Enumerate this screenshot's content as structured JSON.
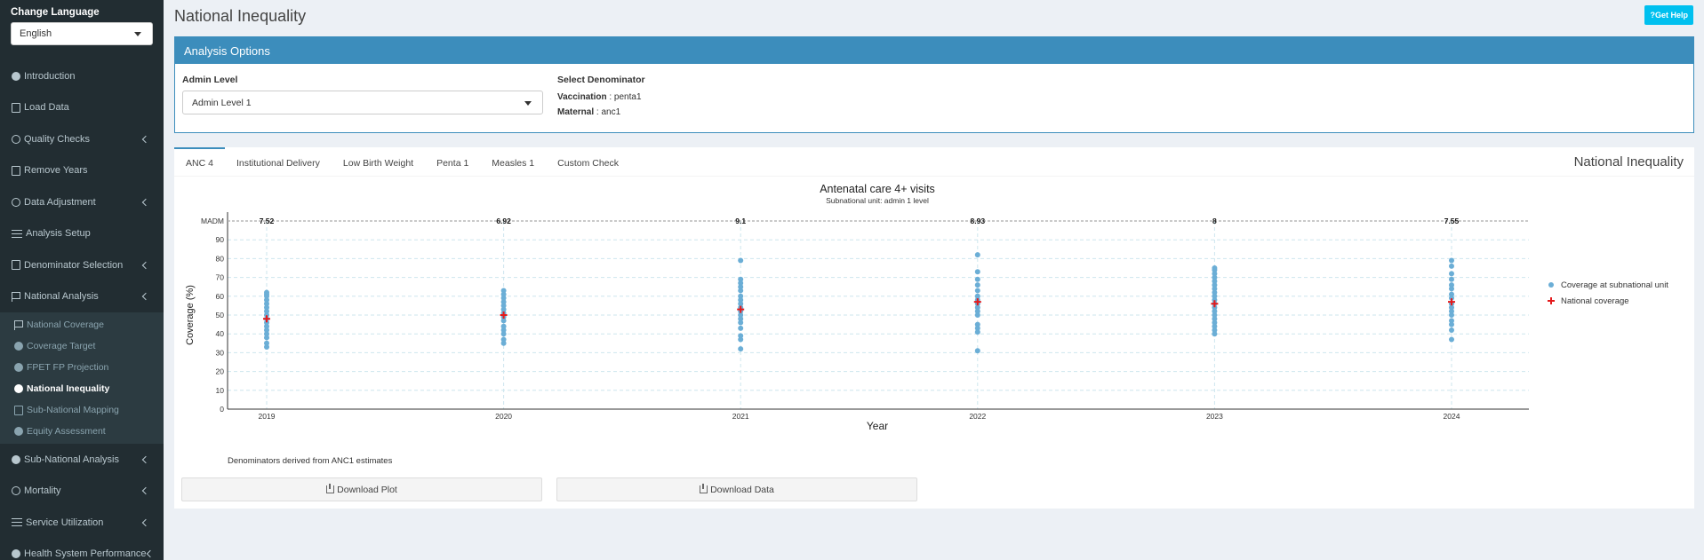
{
  "sidebar": {
    "language_title": "Change Language",
    "language_value": "English",
    "items": [
      {
        "label": "Introduction",
        "icon": "info-circle-icon"
      },
      {
        "label": "Load Data",
        "icon": "upload-icon"
      },
      {
        "label": "Quality Checks",
        "icon": "check-circle-icon",
        "expandable": true
      },
      {
        "label": "Remove Years",
        "icon": "trash-icon"
      },
      {
        "label": "Data Adjustment",
        "icon": "adjust-icon",
        "expandable": true
      },
      {
        "label": "Analysis Setup",
        "icon": "sliders-icon"
      },
      {
        "label": "Denominator Selection",
        "icon": "calculator-icon",
        "expandable": true
      },
      {
        "label": "National Analysis",
        "icon": "flag-icon",
        "expandable": true
      }
    ],
    "sub_items": [
      {
        "label": "National Coverage",
        "icon": "flag-icon"
      },
      {
        "label": "Coverage Target",
        "icon": "user-icon"
      },
      {
        "label": "FPET FP Projection",
        "icon": "user-icon"
      },
      {
        "label": "National Inequality",
        "icon": "balance-icon",
        "active": true
      },
      {
        "label": "Sub-National Mapping",
        "icon": "map-icon"
      },
      {
        "label": "Equity Assessment",
        "icon": "balance-icon"
      }
    ],
    "items_after": [
      {
        "label": "Sub-National Analysis",
        "icon": "globe-icon",
        "expandable": true
      },
      {
        "label": "Mortality",
        "icon": "balance-icon",
        "expandable": true
      },
      {
        "label": "Service Utilization",
        "icon": "sliders-icon",
        "expandable": true
      },
      {
        "label": "Health System Performance",
        "icon": "globe-icon",
        "expandable": true
      }
    ]
  },
  "header": {
    "title": "National Inequality",
    "help_label": "Get Help"
  },
  "analysis_options": {
    "title": "Analysis Options",
    "admin_level_label": "Admin Level",
    "admin_level_value": "Admin Level 1",
    "denominator_title": "Select Denominator",
    "vaccination_label": "Vaccination",
    "vaccination_value": " : penta1",
    "maternal_label": "Maternal",
    "maternal_value": " : anc1"
  },
  "tabs": {
    "items": [
      "ANC 4",
      "Institutional Delivery",
      "Low Birth Weight",
      "Penta 1",
      "Measles 1",
      "Custom Check"
    ],
    "active": 0,
    "panel_title": "National Inequality"
  },
  "chart_data": {
    "type": "scatter",
    "title": "Antenatal care 4+ visits",
    "subtitle": "Subnational unit: admin 1 level",
    "xlabel": "Year",
    "ylabel": "Coverage (%)",
    "ylim": [
      0,
      100
    ],
    "yticks": [
      0,
      10,
      20,
      30,
      40,
      50,
      60,
      70,
      80,
      90
    ],
    "madm_label": "MADM",
    "madm_y": 100,
    "categories": [
      "2019",
      "2020",
      "2021",
      "2022",
      "2023",
      "2024"
    ],
    "madm_values": [
      "7.52",
      "6.92",
      "9.1",
      "8.93",
      "8",
      "7.55"
    ],
    "series": [
      {
        "name": "Coverage at subnational unit",
        "color": "#6baed6",
        "points": [
          [
            33,
            35,
            38,
            40,
            42,
            44,
            46,
            48,
            50,
            52,
            54,
            56,
            58,
            60,
            61,
            62
          ],
          [
            35,
            37,
            40,
            42,
            44,
            47,
            49,
            51,
            53,
            55,
            57,
            59,
            61,
            63
          ],
          [
            32,
            37,
            39,
            43,
            46,
            48,
            50,
            52,
            54,
            56,
            58,
            60,
            63,
            65,
            67,
            69,
            79
          ],
          [
            31,
            41,
            43,
            45,
            50,
            52,
            54,
            56,
            58,
            60,
            63,
            66,
            69,
            73,
            82
          ],
          [
            40,
            42,
            44,
            46,
            48,
            50,
            52,
            54,
            56,
            58,
            60,
            62,
            64,
            66,
            68,
            70,
            72,
            74,
            75
          ],
          [
            37,
            42,
            45,
            47,
            50,
            52,
            54,
            56,
            59,
            61,
            64,
            66,
            69,
            72,
            76,
            79
          ]
        ]
      },
      {
        "name": "National coverage",
        "color": "#e41a1c",
        "values": [
          48,
          50,
          53,
          57,
          56,
          57
        ]
      }
    ],
    "note": "Denominators derived from ANC1 estimates",
    "grid": true,
    "legend_position": "right"
  },
  "buttons": {
    "download_plot": "Download Plot",
    "download_data": "Download Data"
  }
}
